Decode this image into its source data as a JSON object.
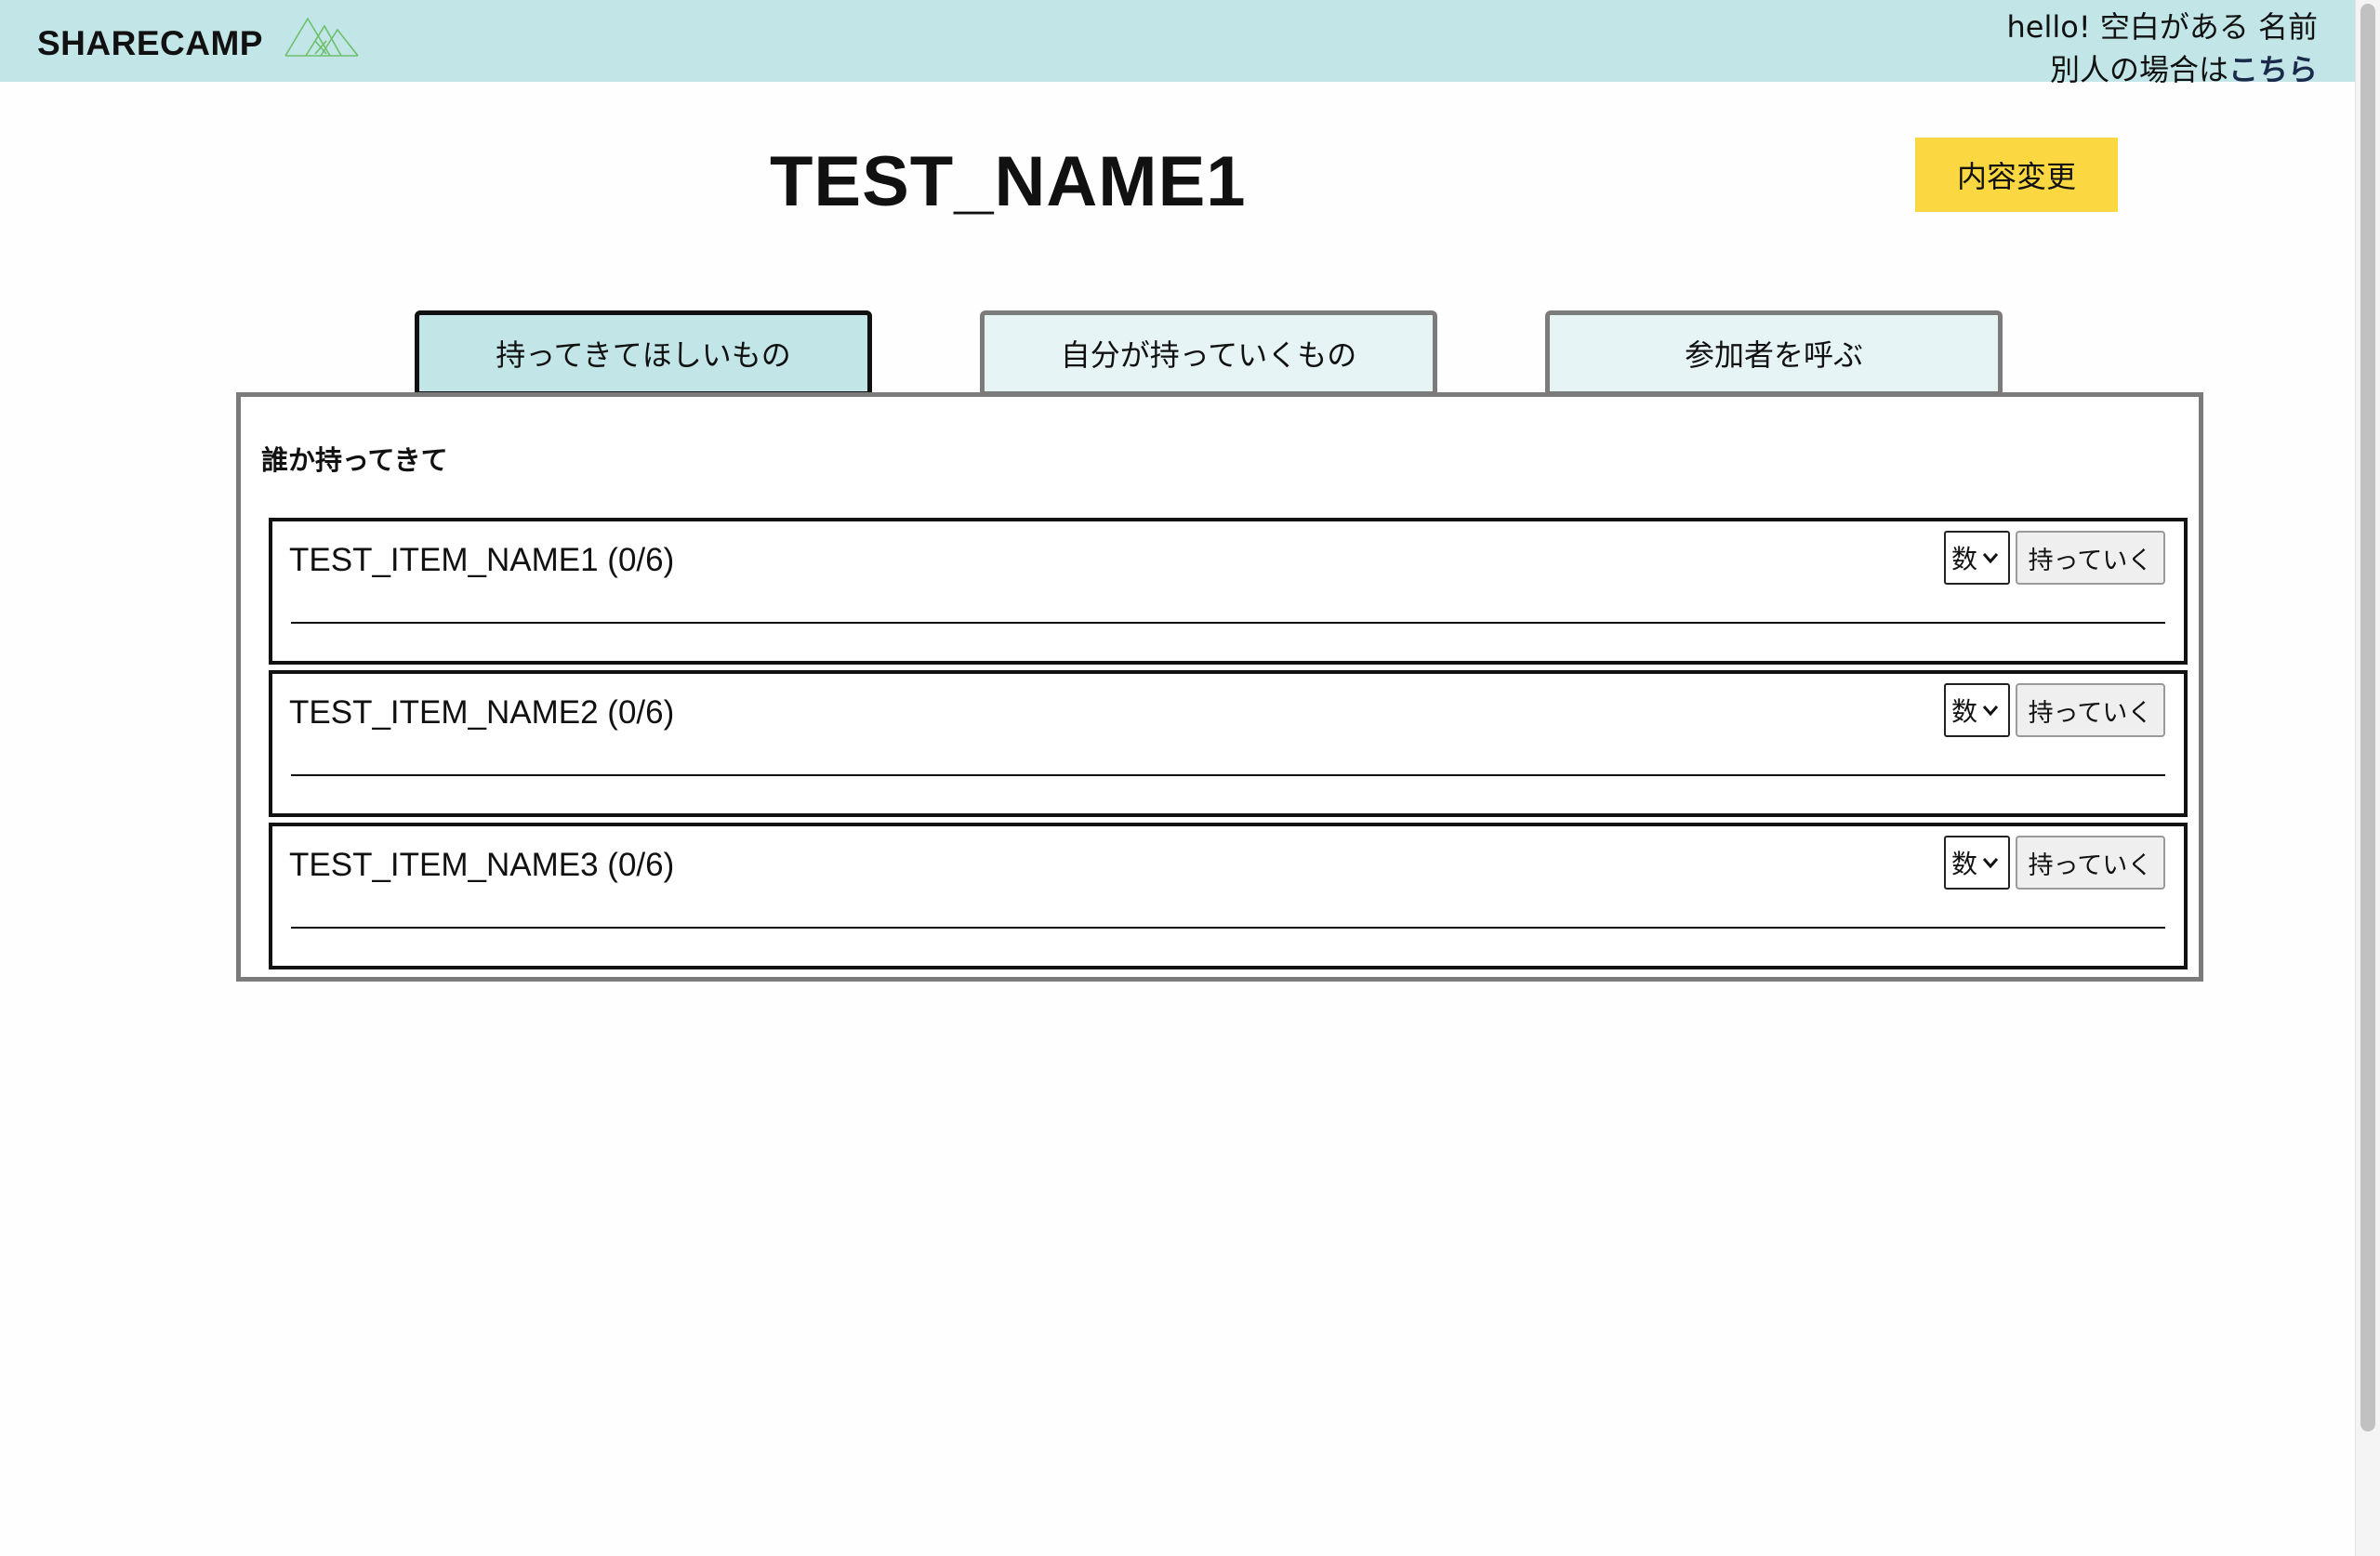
{
  "header": {
    "brand": "SHARECAMP",
    "logo_icon": "mountain-logo-icon",
    "greeting": "hello! 空白がある 名前",
    "switch_prefix": "別人の場合は",
    "switch_link": "こちら",
    "background_color": "#c2e6e7"
  },
  "main": {
    "title": "TEST_NAME1",
    "edit_label": "内容変更",
    "edit_color": "#fbd741"
  },
  "tabs": [
    {
      "label": "持ってきてほしいもの",
      "active": true
    },
    {
      "label": "自分が持っていくもの",
      "active": false
    },
    {
      "label": "参加者を呼ぶ",
      "active": false
    }
  ],
  "panel": {
    "heading": "誰か持ってきて",
    "items": [
      {
        "name": "TEST_ITEM_NAME1 (0/6)",
        "qty_placeholder": "数",
        "bring_label": "持っていく"
      },
      {
        "name": "TEST_ITEM_NAME2 (0/6)",
        "qty_placeholder": "数",
        "bring_label": "持っていく"
      },
      {
        "name": "TEST_ITEM_NAME3 (0/6)",
        "qty_placeholder": "数",
        "bring_label": "持っていく"
      }
    ]
  }
}
